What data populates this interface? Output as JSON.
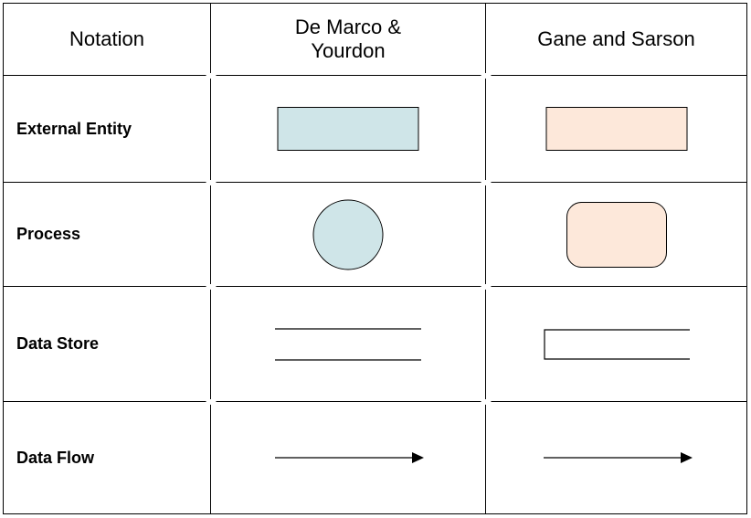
{
  "headers": {
    "col1": "Notation",
    "col2": "De Marco & Yourdon",
    "col3": "Gane and Sarson"
  },
  "rows": [
    {
      "label": "External Entity"
    },
    {
      "label": "Process"
    },
    {
      "label": "Data Store"
    },
    {
      "label": "Data Flow"
    }
  ],
  "colors": {
    "blueFill": "#cfe5e8",
    "peachFill": "#fde8da",
    "stroke": "#000000"
  }
}
